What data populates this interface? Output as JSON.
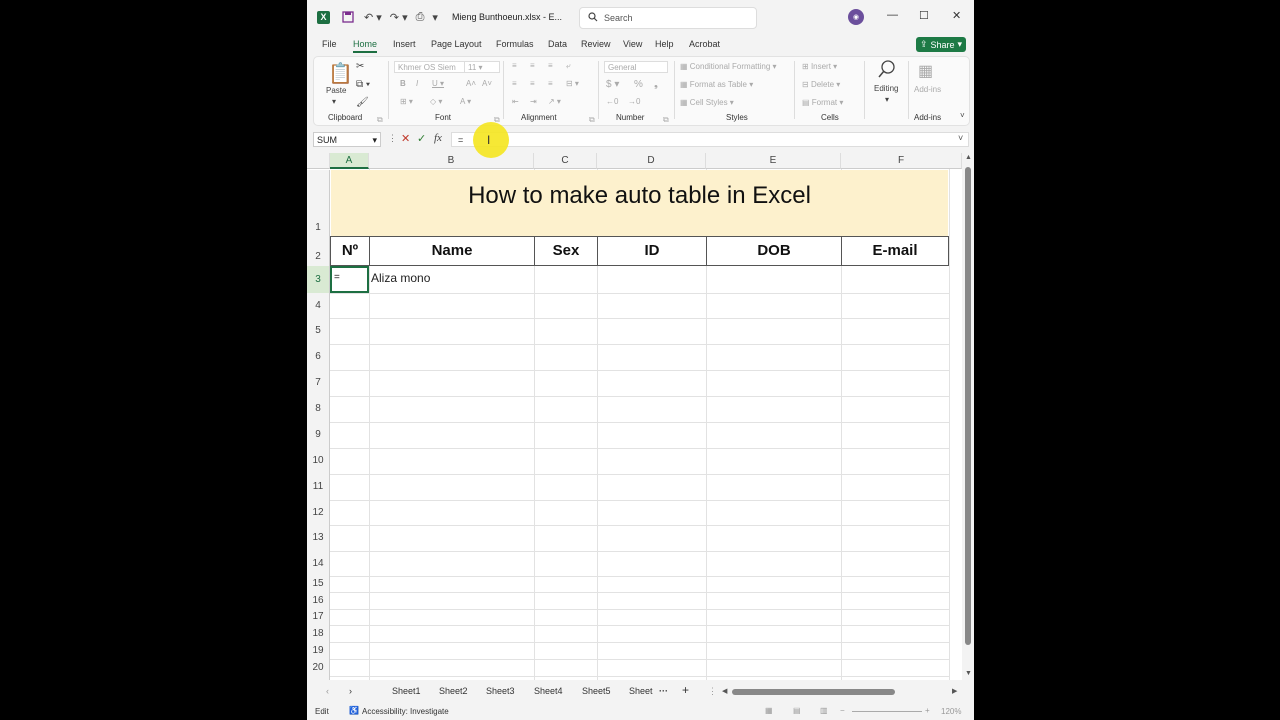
{
  "titlebar": {
    "filename": "Mieng Bunthoeun.xlsx  -  E...",
    "search_placeholder": "Search"
  },
  "menu": {
    "tabs": [
      "File",
      "Home",
      "Insert",
      "Page Layout",
      "Formulas",
      "Data",
      "Review",
      "View",
      "Help",
      "Acrobat"
    ],
    "active": "Home",
    "share_label": "Share"
  },
  "ribbon": {
    "groups": [
      "Clipboard",
      "Font",
      "Alignment",
      "Number",
      "Styles",
      "Cells",
      "Add-ins"
    ],
    "paste_label": "Paste",
    "font_name": "Khmer OS Siem",
    "font_size": "11",
    "number_format": "General",
    "styles_items": [
      "Conditional Formatting",
      "Format as Table",
      "Cell Styles"
    ],
    "cells_items": [
      "Insert",
      "Delete",
      "Format"
    ],
    "editing_label": "Editing",
    "addins_label": "Add-ins"
  },
  "formula_bar": {
    "name_box": "SUM",
    "fx": "fx",
    "content": "="
  },
  "sheet": {
    "columns": [
      "A",
      "B",
      "C",
      "D",
      "E",
      "F"
    ],
    "rows": [
      "1",
      "2",
      "3",
      "4",
      "5",
      "6",
      "7",
      "8",
      "9",
      "10",
      "11",
      "12",
      "13",
      "14",
      "15",
      "16",
      "17",
      "18",
      "19",
      "20"
    ],
    "title": "How to make auto table in Excel",
    "headers": [
      "Nº",
      "Name",
      "Sex",
      "ID",
      "DOB",
      "E-mail"
    ],
    "a3": "=",
    "b3": "Aliza mono"
  },
  "sheet_tabs": [
    "Sheet1",
    "Sheet2",
    "Sheet3",
    "Sheet4",
    "Sheet5",
    "Sheet"
  ],
  "status": {
    "mode": "Edit",
    "accessibility": "Accessibility: Investigate",
    "zoom": "120%"
  }
}
